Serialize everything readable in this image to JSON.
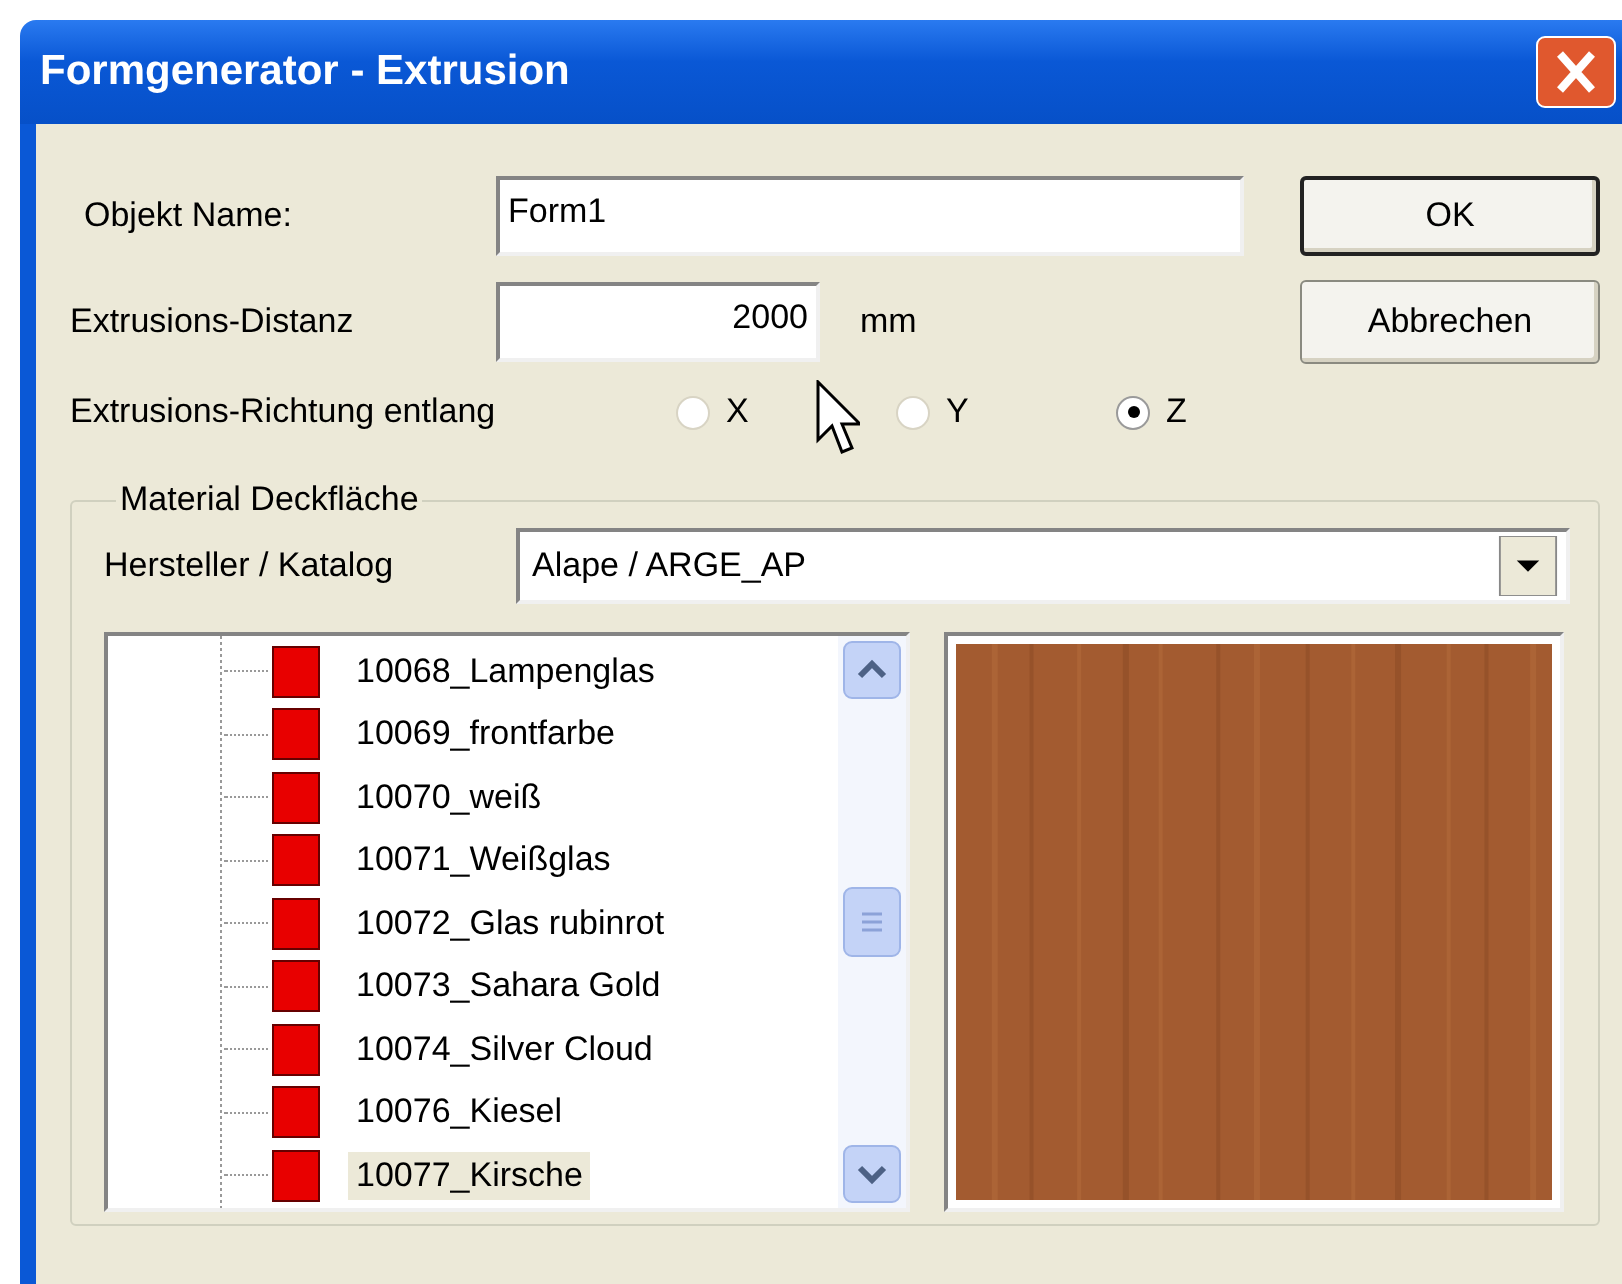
{
  "window": {
    "title": "Formgenerator - Extrusion"
  },
  "name_field": {
    "label": "Objekt Name:",
    "value": "Form1"
  },
  "distance_field": {
    "label": "Extrusions-Distanz",
    "value": "2000",
    "unit": "mm"
  },
  "direction": {
    "label": "Extrusions-Richtung entlang",
    "options": [
      {
        "label": "X",
        "selected": false
      },
      {
        "label": "Y",
        "selected": false
      },
      {
        "label": "Z",
        "selected": true
      }
    ]
  },
  "buttons": [
    "OK",
    "Abbrechen"
  ],
  "material_group": {
    "title": "Material Deckfläche",
    "catalog_label": "Hersteller / Katalog",
    "catalog_value": "Alape / ARGE_AP",
    "items": [
      {
        "label": "10068_Lampenglas",
        "selected": false
      },
      {
        "label": "10069_frontfarbe",
        "selected": false
      },
      {
        "label": "10070_weiß",
        "selected": false
      },
      {
        "label": "10071_Weißglas",
        "selected": false
      },
      {
        "label": "10072_Glas rubinrot",
        "selected": false
      },
      {
        "label": "10073_Sahara Gold",
        "selected": false
      },
      {
        "label": "10074_Silver Cloud",
        "selected": false
      },
      {
        "label": "10076_Kiesel",
        "selected": false
      },
      {
        "label": "10077_Kirsche",
        "selected": true
      }
    ]
  }
}
